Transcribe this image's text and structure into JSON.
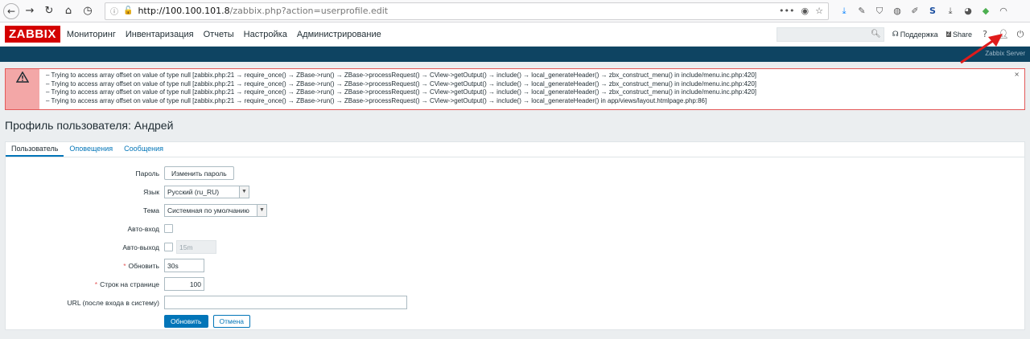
{
  "browser": {
    "url_host": "http://100.100.101.8",
    "url_path": "/zabbix.php?action=userprofile.edit",
    "more_label": "•••"
  },
  "header": {
    "logo": "ZABBIX",
    "menu": [
      "Мониторинг",
      "Инвентаризация",
      "Отчеты",
      "Настройка",
      "Администрирование"
    ],
    "support": "Поддержка",
    "share": "Share",
    "help": "?",
    "server_name": "Zabbix Server"
  },
  "error": {
    "lines": [
      "– Trying to access array offset on value of type null [zabbix.php:21 → require_once() → ZBase->run() → ZBase->processRequest() → CView->getOutput() → include() → local_generateHeader() → zbx_construct_menu() in include/menu.inc.php:420]",
      "– Trying to access array offset on value of type null [zabbix.php:21 → require_once() → ZBase->run() → ZBase->processRequest() → CView->getOutput() → include() → local_generateHeader() → zbx_construct_menu() in include/menu.inc.php:420]",
      "– Trying to access array offset on value of type null [zabbix.php:21 → require_once() → ZBase->run() → ZBase->processRequest() → CView->getOutput() → include() → local_generateHeader() → zbx_construct_menu() in include/menu.inc.php:420]",
      "– Trying to access array offset on value of type null [zabbix.php:21 → require_once() → ZBase->run() → ZBase->processRequest() → CView->getOutput() → include() → local_generateHeader() in app/views/layout.htmlpage.php:86]"
    ],
    "close": "×"
  },
  "page": {
    "title": "Профиль пользователя: Андрей"
  },
  "tabs": [
    "Пользователь",
    "Оповещения",
    "Сообщения"
  ],
  "form": {
    "password_label": "Пароль",
    "password_button": "Изменить пароль",
    "language_label": "Язык",
    "language_value": "Русский (ru_RU)",
    "theme_label": "Тема",
    "theme_value": "Системная по умолчанию",
    "autologin_label": "Авто-вход",
    "autologout_label": "Авто-выход",
    "autologout_value": "15m",
    "refresh_label": "Обновить",
    "refresh_value": "30s",
    "rows_label": "Строк на странице",
    "rows_value": "100",
    "url_label": "URL (после входа в систему)",
    "url_value": "",
    "required_mark": "*",
    "submit": "Обновить",
    "cancel": "Отмена"
  }
}
